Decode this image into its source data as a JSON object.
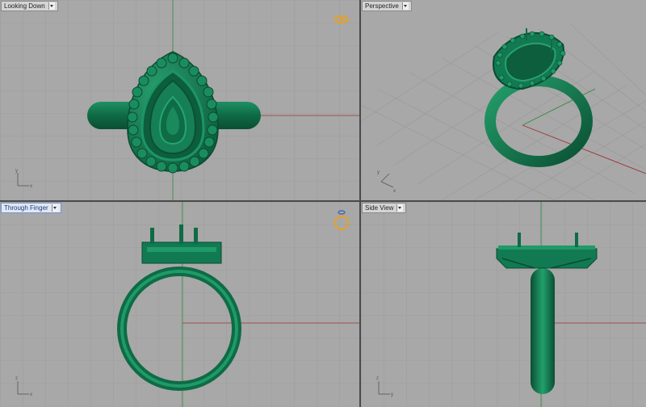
{
  "viewports": {
    "top": {
      "label": "Looking Down"
    },
    "perspective": {
      "label": "Perspective"
    },
    "front": {
      "label": "Through Finger"
    },
    "side": {
      "label": "Side View"
    }
  },
  "axes": {
    "x": "x",
    "y": "y",
    "z": "z"
  },
  "colors": {
    "background": "#a8a8a8",
    "grid": "#9a9a9a",
    "model": "#127a52",
    "x_axis": "#a03030",
    "y_axis": "#2e8b3c",
    "active_label": "#dfe8f5",
    "gizmo": "#e8a020"
  },
  "icons": [
    "dropdown-icon",
    "view-cube-icon",
    "rotation-gizmo-icon"
  ]
}
